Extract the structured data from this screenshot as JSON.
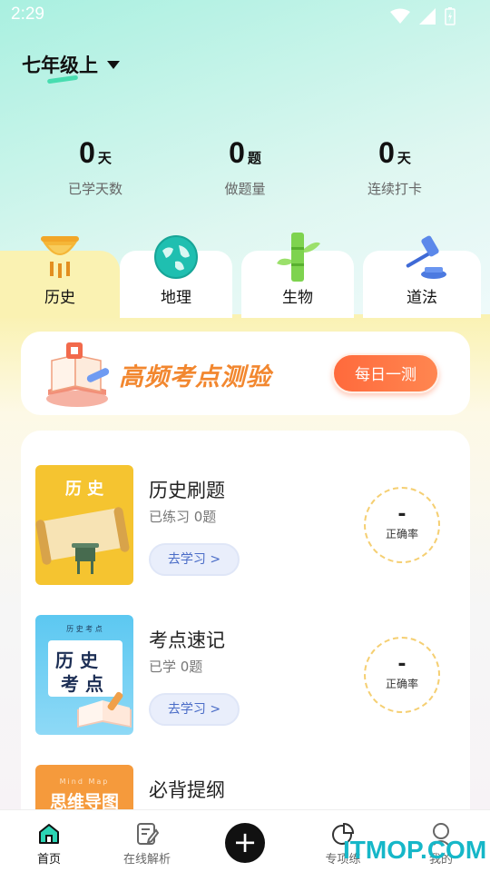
{
  "status_bar": {
    "time": "2:29"
  },
  "grade": {
    "label": "七年级上"
  },
  "stats": [
    {
      "value": "0",
      "unit": "天",
      "label": "已学天数"
    },
    {
      "value": "0",
      "unit": "题",
      "label": "做题量"
    },
    {
      "value": "0",
      "unit": "天",
      "label": "连续打卡"
    }
  ],
  "tabs": [
    {
      "label": "历史",
      "icon": "bronze-ding-icon",
      "active": true
    },
    {
      "label": "地理",
      "icon": "globe-icon",
      "active": false
    },
    {
      "label": "生物",
      "icon": "bamboo-icon",
      "active": false
    },
    {
      "label": "道法",
      "icon": "gavel-icon",
      "active": false
    }
  ],
  "banner": {
    "title": "高频考点测验",
    "button": "每日一测"
  },
  "items": [
    {
      "title": "历史刷题",
      "subtitle": "已练习 0题",
      "button": "去学习 >",
      "accuracy_value": "-",
      "accuracy_label": "正确率",
      "cover_text": "历 史"
    },
    {
      "title": "考点速记",
      "subtitle": "已学 0题",
      "button": "去学习 >",
      "accuracy_value": "-",
      "accuracy_label": "正确率",
      "cover_small": "历  史  考  点",
      "cover_line1": "历 史",
      "cover_line2": "考 点"
    },
    {
      "title": "必背提纲",
      "cover_small": "Mind Map",
      "cover_text": "思维导图"
    }
  ],
  "bottom_nav": {
    "home": "首页",
    "analysis": "在线解析",
    "add": "+",
    "practice": "专项练",
    "mine": "我的"
  },
  "watermark": "ITMOP.COM",
  "colors": {
    "accent": "#ff6a3c",
    "active_tab": "#faf2b2",
    "ring": "#f5cf72"
  }
}
